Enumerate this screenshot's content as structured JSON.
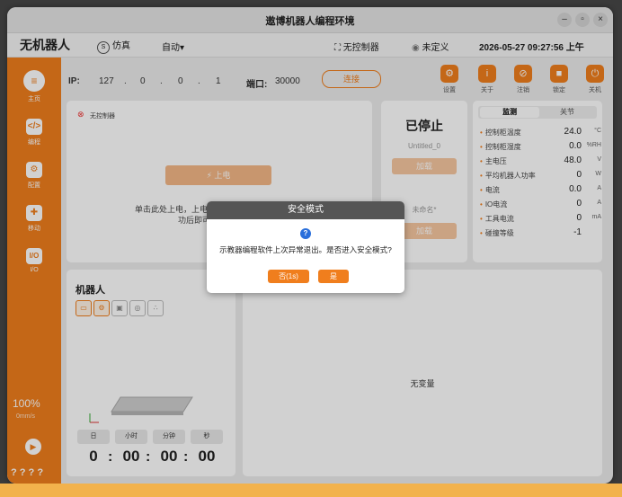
{
  "window": {
    "title": "遨博机器人编程环境"
  },
  "menubar": {
    "app_name": "无机器人",
    "sim_badge": "S",
    "sim_label": "仿真",
    "mode_label": "自动▾",
    "controller_label": "无控制器",
    "undefined_label": "未定义",
    "datetime": "2026-05-27 09:27:56 上午"
  },
  "sidebar": {
    "items": [
      {
        "label": "主页",
        "icon": "home-icon"
      },
      {
        "label": "编程",
        "icon": "code-icon"
      },
      {
        "label": "配置",
        "icon": "config-icon"
      },
      {
        "label": "移动",
        "icon": "move-icon"
      },
      {
        "label": "I/O",
        "icon": "io-icon"
      }
    ],
    "io_glyph": "I/O",
    "speed_percent": "100%",
    "speed_unit": "0mm/s",
    "bottom_marks": "? ? ? ?"
  },
  "topbar": {
    "ip_label": "IP:",
    "ip_parts": [
      "127",
      ".",
      "0",
      ".",
      "0",
      ".",
      "1"
    ],
    "port_label": "端口:",
    "port_value": "30000",
    "connect_label": "连接",
    "icons": [
      {
        "label": "设置",
        "icon": "settings-icon"
      },
      {
        "label": "关于",
        "icon": "info-icon"
      },
      {
        "label": "注销",
        "icon": "logout-icon"
      },
      {
        "label": "锁定",
        "icon": "lock-icon"
      },
      {
        "label": "关机",
        "icon": "power-icon"
      }
    ]
  },
  "status_panel": {
    "no_controller": "无控制器",
    "power_on_label": "上电",
    "hint_line1": "单击此处上电，上电",
    "hint_line2": "功后即可"
  },
  "program_panel": {
    "state": "已停止",
    "program_name": "Untitled_0",
    "load_label": "加载",
    "unnamed_label": "未命名*",
    "load_label_2": "加载"
  },
  "monitor": {
    "tab_active": "监测",
    "tab_inactive": "关节",
    "rows": [
      {
        "label": "控制柜温度",
        "value": "24.0",
        "unit": "°C"
      },
      {
        "label": "控制柜湿度",
        "value": "0.0",
        "unit": "%RH"
      },
      {
        "label": "主电压",
        "value": "48.0",
        "unit": "V"
      },
      {
        "label": "平均机器人功率",
        "value": "0",
        "unit": "W"
      },
      {
        "label": "电流",
        "value": "0.0",
        "unit": "A"
      },
      {
        "label": "IO电流",
        "value": "0",
        "unit": "A"
      },
      {
        "label": "工具电流",
        "value": "0",
        "unit": "mA"
      },
      {
        "label": "碰撞等级",
        "value": "-1",
        "unit": ""
      }
    ]
  },
  "robot_panel": {
    "title": "机器人",
    "time_labels": [
      "日",
      "小时",
      "分钟",
      "秒"
    ],
    "time_values": [
      "0",
      "00",
      "00",
      "00"
    ]
  },
  "variables_panel": {
    "empty_label": "无变量"
  },
  "dialog": {
    "title": "安全模式",
    "message": "示教器编程软件上次异常退出。是否进入安全模式?",
    "no_label": "否(1s)",
    "yes_label": "是"
  }
}
